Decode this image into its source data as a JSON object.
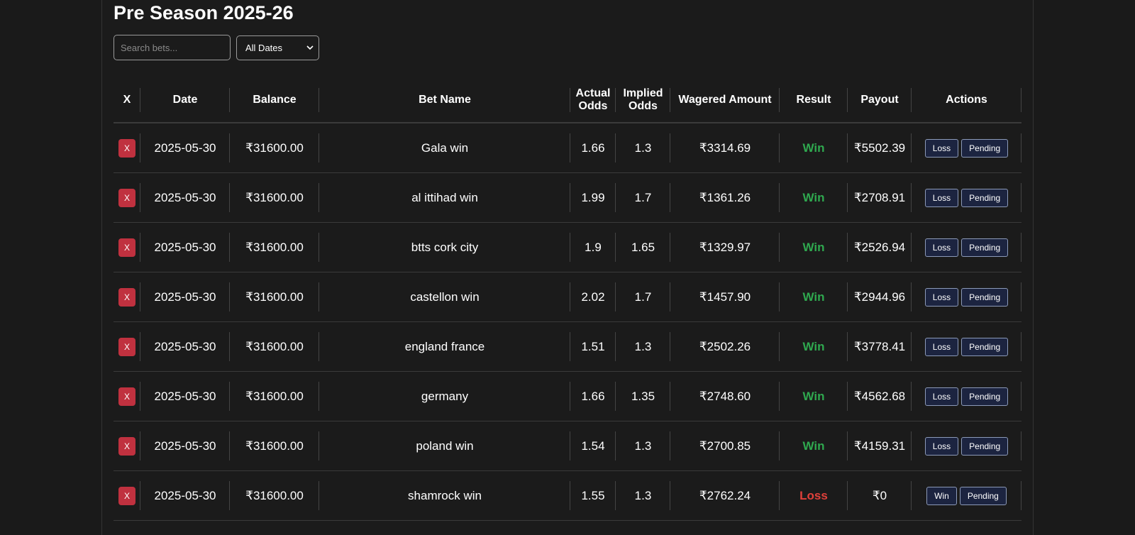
{
  "page": {
    "title": "Pre Season 2025-26"
  },
  "filters": {
    "search_placeholder": "Search bets...",
    "date_selected": "All Dates"
  },
  "table": {
    "headers": {
      "delete": "X",
      "date": "Date",
      "balance": "Balance",
      "bet_name": "Bet Name",
      "actual_odds_1": "Actual",
      "actual_odds_2": "Odds",
      "implied_odds_1": "Implied",
      "implied_odds_2": "Odds",
      "wagered": "Wagered Amount",
      "result": "Result",
      "payout": "Payout",
      "actions": "Actions"
    },
    "delete_label": "X",
    "rows": [
      {
        "date": "2025-05-30",
        "balance": "₹31600.00",
        "bet_name": "Gala win",
        "actual_odds": "1.66",
        "implied_odds": "1.3",
        "wagered": "₹3314.69",
        "result": "Win",
        "payout": "₹5502.39",
        "action1": "Loss",
        "action2": "Pending"
      },
      {
        "date": "2025-05-30",
        "balance": "₹31600.00",
        "bet_name": "al ittihad win",
        "actual_odds": "1.99",
        "implied_odds": "1.7",
        "wagered": "₹1361.26",
        "result": "Win",
        "payout": "₹2708.91",
        "action1": "Loss",
        "action2": "Pending"
      },
      {
        "date": "2025-05-30",
        "balance": "₹31600.00",
        "bet_name": "btts cork city",
        "actual_odds": "1.9",
        "implied_odds": "1.65",
        "wagered": "₹1329.97",
        "result": "Win",
        "payout": "₹2526.94",
        "action1": "Loss",
        "action2": "Pending"
      },
      {
        "date": "2025-05-30",
        "balance": "₹31600.00",
        "bet_name": "castellon win",
        "actual_odds": "2.02",
        "implied_odds": "1.7",
        "wagered": "₹1457.90",
        "result": "Win",
        "payout": "₹2944.96",
        "action1": "Loss",
        "action2": "Pending"
      },
      {
        "date": "2025-05-30",
        "balance": "₹31600.00",
        "bet_name": "england france",
        "actual_odds": "1.51",
        "implied_odds": "1.3",
        "wagered": "₹2502.26",
        "result": "Win",
        "payout": "₹3778.41",
        "action1": "Loss",
        "action2": "Pending"
      },
      {
        "date": "2025-05-30",
        "balance": "₹31600.00",
        "bet_name": "germany",
        "actual_odds": "1.66",
        "implied_odds": "1.35",
        "wagered": "₹2748.60",
        "result": "Win",
        "payout": "₹4562.68",
        "action1": "Loss",
        "action2": "Pending"
      },
      {
        "date": "2025-05-30",
        "balance": "₹31600.00",
        "bet_name": "poland win",
        "actual_odds": "1.54",
        "implied_odds": "1.3",
        "wagered": "₹2700.85",
        "result": "Win",
        "payout": "₹4159.31",
        "action1": "Loss",
        "action2": "Pending"
      },
      {
        "date": "2025-05-30",
        "balance": "₹31600.00",
        "bet_name": "shamrock win",
        "actual_odds": "1.55",
        "implied_odds": "1.3",
        "wagered": "₹2762.24",
        "result": "Loss",
        "payout": "₹0",
        "action1": "Win",
        "action2": "Pending"
      }
    ]
  },
  "colors": {
    "background": "#1a1a1a",
    "win": "#2fa84f",
    "loss": "#e0403a",
    "delete_button": "#c0313f",
    "action_button_bg": "#1c2440"
  }
}
